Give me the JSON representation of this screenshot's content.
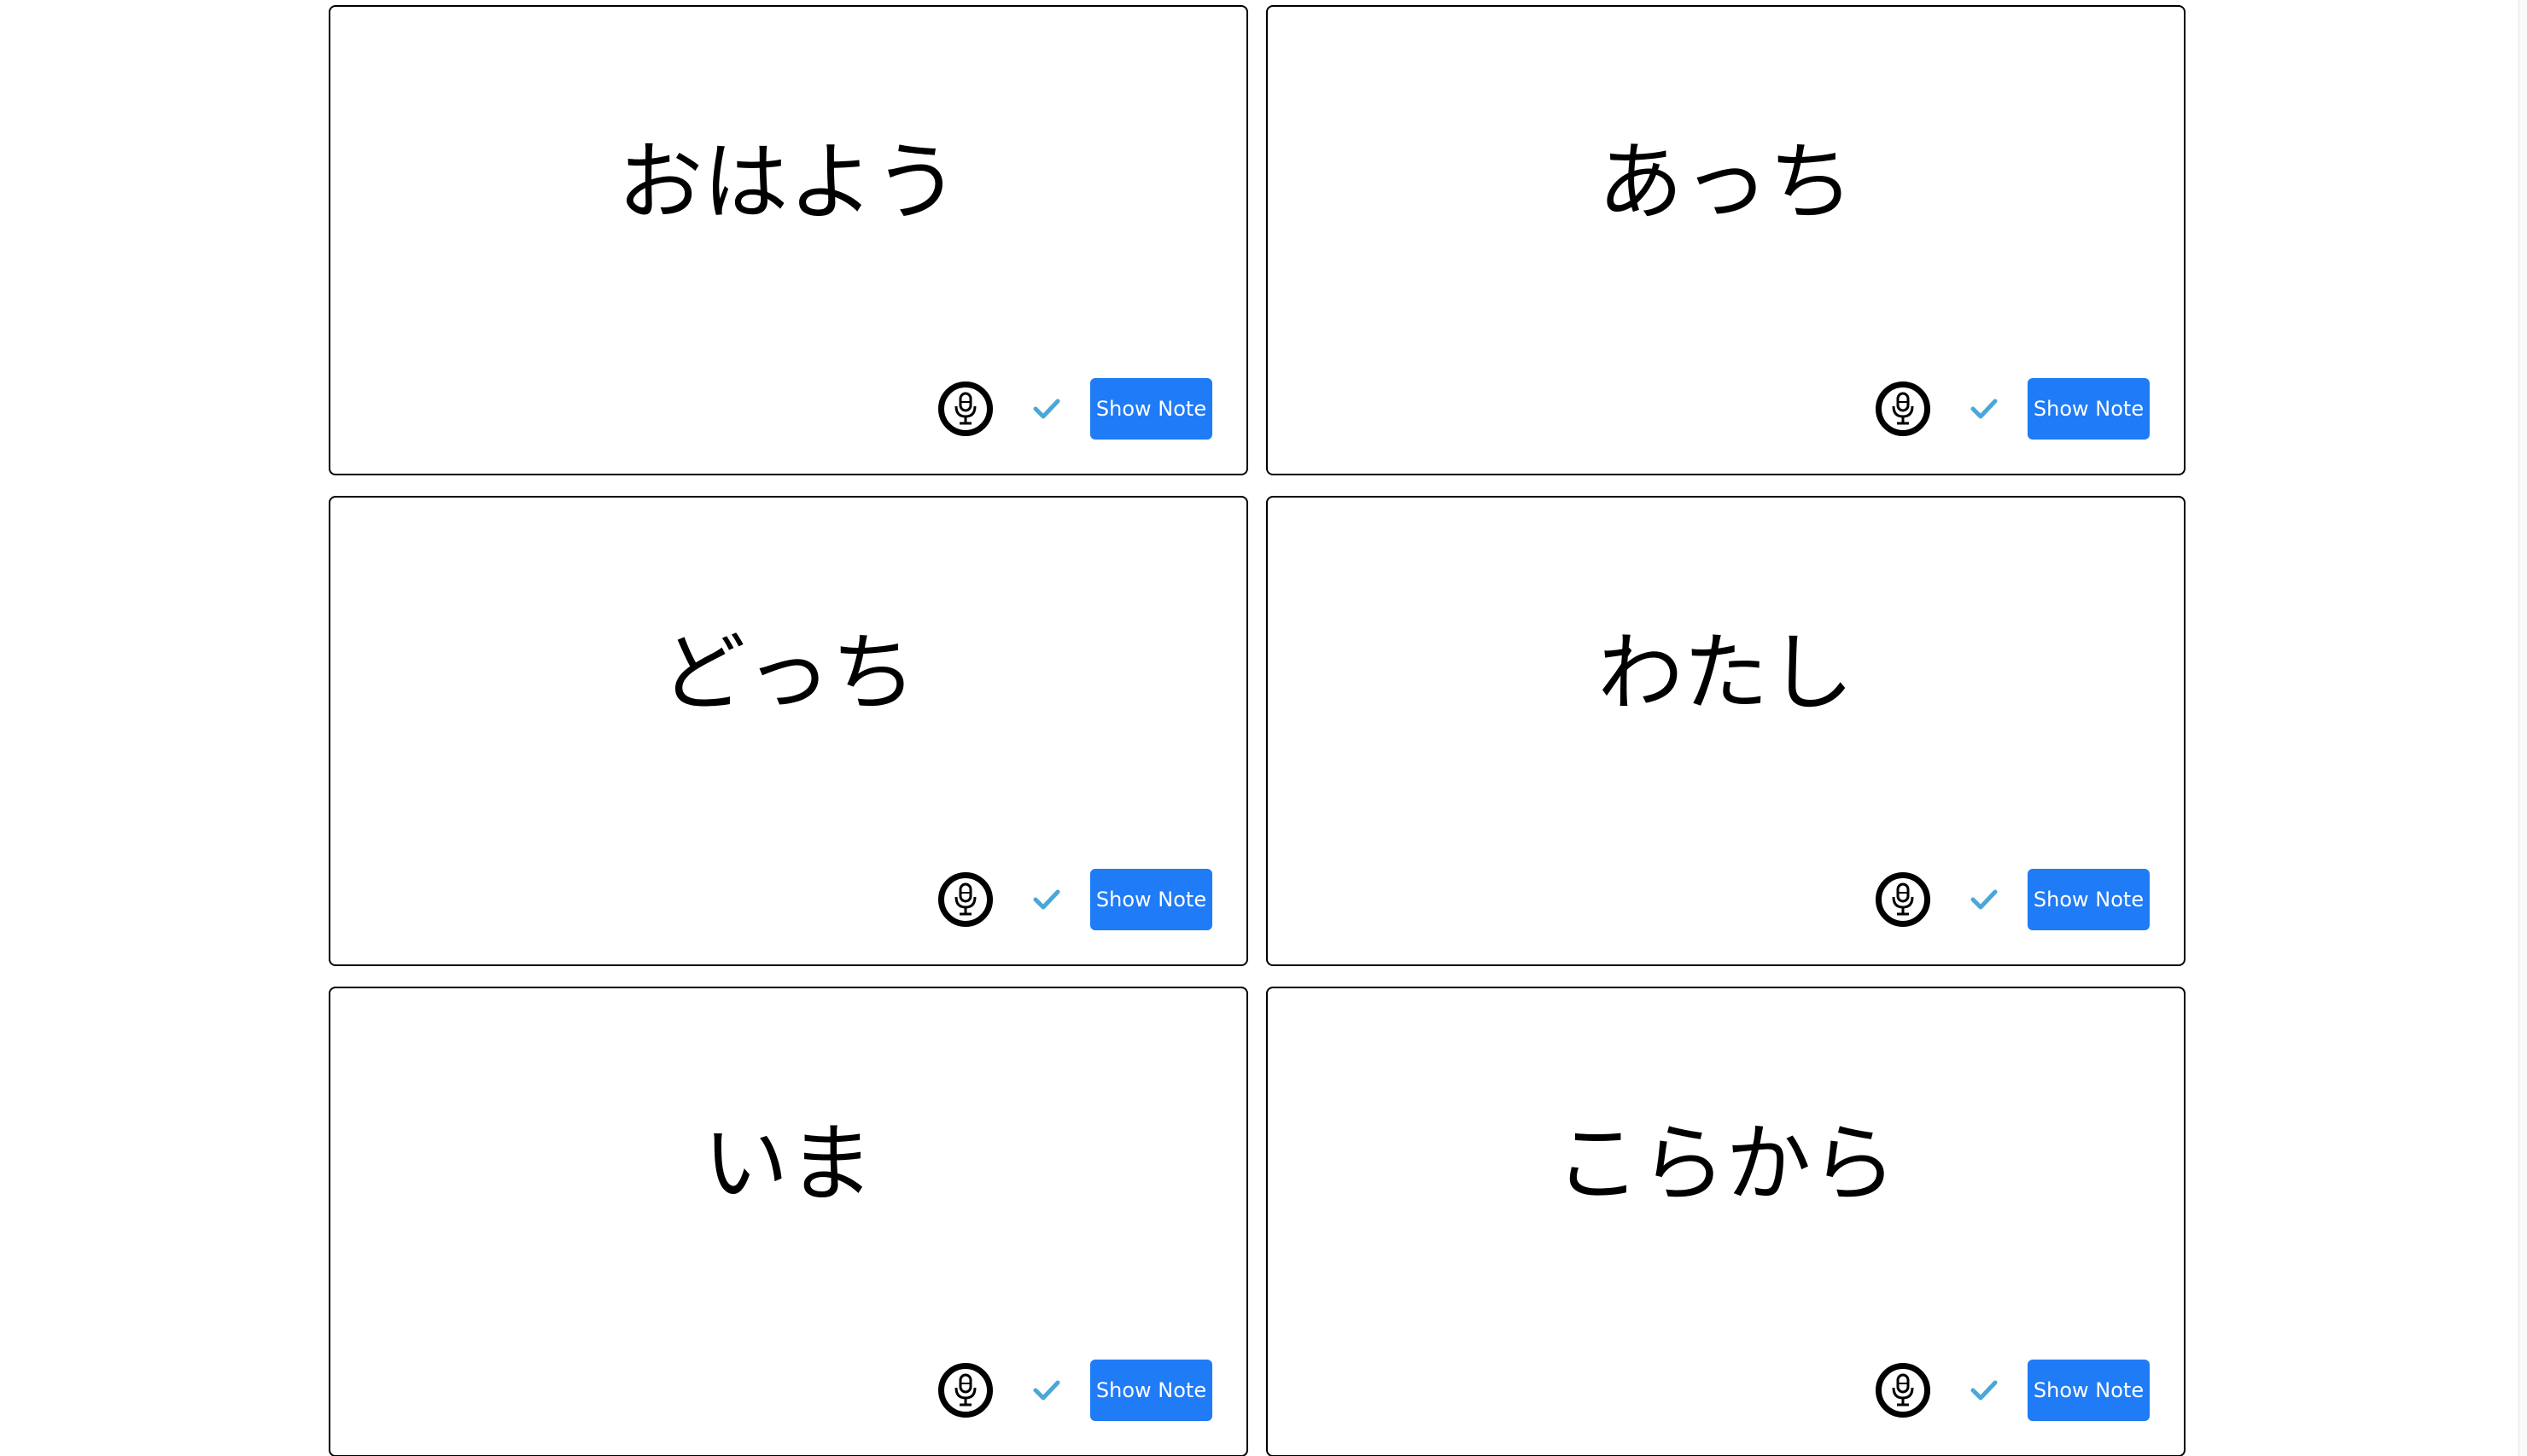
{
  "cards": [
    {
      "word": "おはよう",
      "mic_icon": "microphone-icon",
      "check_icon": "check-icon",
      "note_button": "Show Note"
    },
    {
      "word": "あっち",
      "mic_icon": "microphone-icon",
      "check_icon": "check-icon",
      "note_button": "Show Note"
    },
    {
      "word": "どっち",
      "mic_icon": "microphone-icon",
      "check_icon": "check-icon",
      "note_button": "Show Note"
    },
    {
      "word": "わたし",
      "mic_icon": "microphone-icon",
      "check_icon": "check-icon",
      "note_button": "Show Note"
    },
    {
      "word": "いま",
      "mic_icon": "microphone-icon",
      "check_icon": "check-icon",
      "note_button": "Show Note"
    },
    {
      "word": "こらから",
      "mic_icon": "microphone-icon",
      "check_icon": "check-icon",
      "note_button": "Show Note"
    }
  ],
  "colors": {
    "button_blue": "#1f7bf6",
    "check_teal": "#4aa8d8",
    "card_border": "#000000"
  }
}
